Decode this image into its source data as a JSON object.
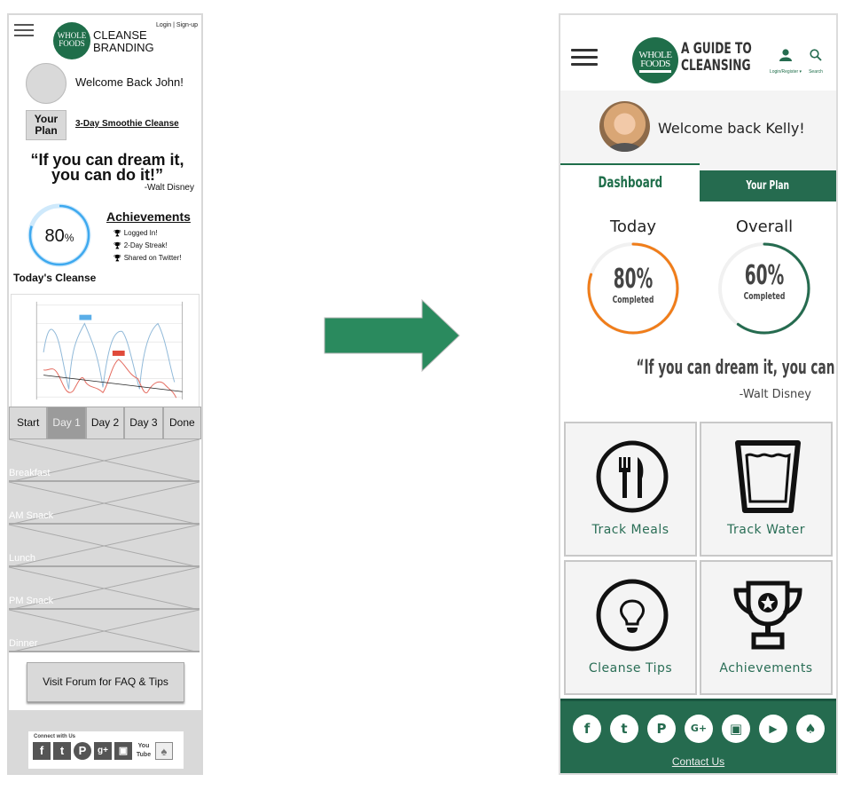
{
  "wireframe": {
    "header": {
      "logo_text": [
        "WHOLE",
        "FOODS"
      ],
      "brand_lines": [
        "CLEANSE",
        "BRANDING"
      ],
      "login_link": "Login | Sign-up"
    },
    "welcome": "Welcome Back John!",
    "your_plan_button": "Your Plan",
    "plan_link": "3-Day Smoothie Cleanse",
    "quote": "“If you can dream it, you can do it!”",
    "quote_author": "-Walt Disney",
    "progress": {
      "value": 80,
      "unit": "%",
      "label": "Today's Cleanse"
    },
    "achievements": {
      "title": "Achievements",
      "items": [
        "Logged In!",
        "2-Day Streak!",
        "Shared on Twitter!"
      ]
    },
    "chart_placeholder": {
      "series_colors": {
        "primary": "#8fb8d8",
        "secondary": "#e46a5e",
        "trend": "#222222"
      },
      "marker_colors": {
        "blue": "#5aaee8",
        "red": "#e04a3a"
      }
    },
    "day_tabs": [
      "Start",
      "Day 1",
      "Day 2",
      "Day 3",
      "Done"
    ],
    "active_day_tab": "Day 1",
    "meals": [
      "Breakfast",
      "AM Snack",
      "Lunch",
      "PM Snack",
      "Dinner"
    ],
    "forum_button": "Visit Forum for FAQ & Tips",
    "footer": {
      "connect_label": "Connect with Us",
      "socials": [
        "facebook",
        "twitter",
        "pinterest",
        "google-plus",
        "instagram",
        "youtube",
        "snapchat"
      ]
    }
  },
  "arrow": {
    "color": "#2a8a5e"
  },
  "mockup": {
    "header": {
      "logo_text": [
        "WHOLE",
        "FOODS"
      ],
      "title_lines": [
        "A GUIDE TO",
        "CLEANSING"
      ],
      "login_label": "Login/Register ▾",
      "search_label": "Search"
    },
    "welcome": "Welcome back Kelly!",
    "tabs": [
      {
        "label": "Dashboard",
        "active": true
      },
      {
        "label": "Your Plan",
        "active": false
      }
    ],
    "gauges": [
      {
        "label": "Today",
        "value": 80,
        "display": "80%",
        "sub": "Completed",
        "color": "#f07d1a"
      },
      {
        "label": "Overall",
        "value": 60,
        "display": "60%",
        "sub": "Completed",
        "color": "#256b4f"
      }
    ],
    "quote": "“If you can dream it, you can do it!”",
    "quote_author": "-Walt Disney",
    "tiles": [
      {
        "label": "Track Meals",
        "icon": "fork-knife-icon"
      },
      {
        "label": "Track Water",
        "icon": "water-glass-icon"
      },
      {
        "label": "Cleanse Tips",
        "icon": "lightbulb-icon"
      },
      {
        "label": "Achievements",
        "icon": "trophy-icon"
      }
    ],
    "footer": {
      "socials": [
        {
          "name": "facebook",
          "glyph": "f"
        },
        {
          "name": "twitter",
          "glyph": "t"
        },
        {
          "name": "pinterest",
          "glyph": "P"
        },
        {
          "name": "google-plus",
          "glyph": "G+"
        },
        {
          "name": "instagram",
          "glyph": "▣"
        },
        {
          "name": "youtube",
          "glyph": "▶"
        },
        {
          "name": "snapchat",
          "glyph": "♠"
        }
      ],
      "contact_link": "Contact Us"
    },
    "colors": {
      "brand_green": "#256b4f",
      "accent_orange": "#f07d1a",
      "tile_bg": "#f4f4f4"
    }
  }
}
